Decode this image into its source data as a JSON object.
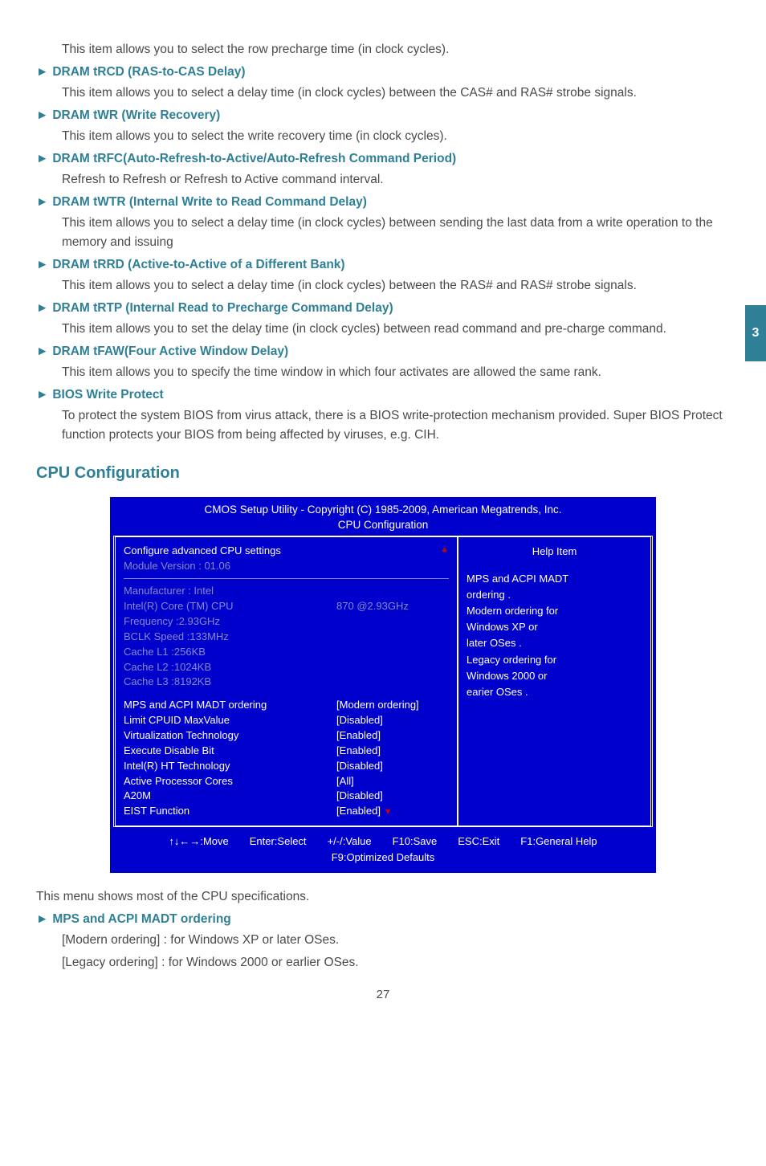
{
  "sideTab": "3",
  "intro": "This item allows you to select the row precharge time (in clock cycles).",
  "items": [
    {
      "title": "DRAM tRCD (RAS-to-CAS Delay)",
      "desc": [
        "This item allows you to select a delay time (in clock cycles) between the CAS# and RAS# strobe signals."
      ]
    },
    {
      "title": "DRAM tWR (Write Recovery)",
      "desc": [
        "This item allows you to select the write recovery time (in clock cycles)."
      ]
    },
    {
      "title": "DRAM tRFC(Auto-Refresh-to-Active/Auto-Refresh Command Period)",
      "desc": [
        "Refresh to Refresh or Refresh to Active command interval."
      ]
    },
    {
      "title": "DRAM tWTR (Internal Write to Read Command Delay)",
      "desc": [
        "This item allows you to select a delay time (in clock cycles) between sending the last data from a write operation to the memory and issuing"
      ]
    },
    {
      "title": "DRAM tRRD (Active-to-Active of a Different Bank)",
      "desc": [
        "This item allows you to select a delay time (in clock cycles) between the RAS# and RAS# strobe signals."
      ]
    },
    {
      "title": "DRAM tRTP (Internal Read to Precharge Command Delay)",
      "desc": [
        "This item allows you to set the delay time (in clock cycles) between read command and pre-charge command."
      ]
    },
    {
      "title": "DRAM tFAW(Four Active Window Delay)",
      "desc": [
        "This item allows you to specify the time window in which four activates are allowed the same rank."
      ]
    },
    {
      "title": "BIOS Write Protect",
      "desc": [
        "To protect the system BIOS from virus attack, there is a BIOS write-protection mechanism provided. Super BIOS Protect function protects your BIOS from being affected by viruses, e.g. CIH."
      ]
    }
  ],
  "sectionTitle": "CPU Configuration",
  "bios": {
    "headerLine1": "CMOS Setup Utility - Copyright (C) 1985-2009, American Megatrends, Inc.",
    "headerLine2": "CPU Configuration",
    "leftTop": [
      {
        "label": "Configure advanced CPU settings",
        "val": "",
        "cls": "white"
      },
      {
        "label": "Module Version : 01.06",
        "val": "",
        "cls": "muted"
      }
    ],
    "sysInfo": [
      {
        "label": "Manufacturer : Intel",
        "val": ""
      },
      {
        "label": "Intel(R) Core (TM) CPU",
        "val": "870  @2.93GHz"
      },
      {
        "label": "Frequency     :2.93GHz",
        "val": ""
      },
      {
        "label": "BCLK Speed  :133MHz",
        "val": ""
      },
      {
        "label": "Cache L1     :256KB",
        "val": ""
      },
      {
        "label": "Cache L2     :1024KB",
        "val": ""
      },
      {
        "label": "Cache L3     :8192KB",
        "val": ""
      }
    ],
    "options": [
      {
        "label": "MPS and ACPI MADT ordering",
        "val": "[Modern ordering]"
      },
      {
        "label": "Limit CPUID MaxValue",
        "val": "[Disabled]"
      },
      {
        "label": "Virtualization Technology",
        "val": "[Enabled]"
      },
      {
        "label": "Execute Disable Bit",
        "val": "[Enabled]"
      },
      {
        "label": "Intel(R) HT Technology",
        "val": "[Disabled]"
      },
      {
        "label": "Active Processor Cores",
        "val": "[All]"
      },
      {
        "label": "A20M",
        "val": "[Disabled]"
      },
      {
        "label": "EIST Function",
        "val": "[Enabled]"
      }
    ],
    "helpHead": "Help Item",
    "helpBody": [
      "MPS and ACPI MADT",
      "ordering .",
      "Modern ordering for",
      "Windows XP or",
      "later OSes .",
      "Legacy ordering for",
      "Windows 2000 or",
      "earier OSes ."
    ],
    "footer1": [
      "↑↓←→:Move",
      "Enter:Select",
      "+/-/:Value",
      "F10:Save",
      "ESC:Exit",
      "F1:General Help"
    ],
    "footer2": "F9:Optimized Defaults"
  },
  "afterBios": "This menu shows most of the CPU specifications.",
  "lastItem": {
    "title": "MPS and ACPI MADT ordering",
    "desc": [
      "[Modern ordering] : for Windows XP or later OSes.",
      "[Legacy ordering] : for Windows 2000 or earlier OSes."
    ]
  },
  "pageNum": "27"
}
